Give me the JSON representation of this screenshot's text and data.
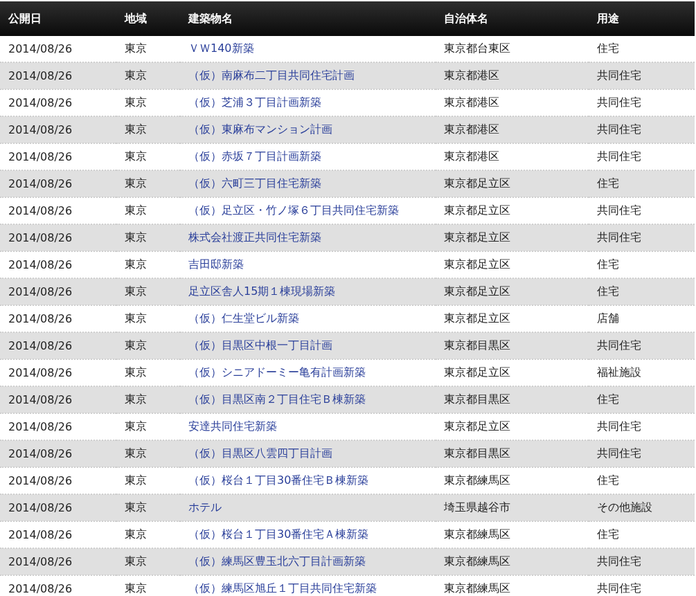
{
  "table": {
    "columns": [
      "公開日",
      "地域",
      "建築物名",
      "自治体名",
      "用途"
    ],
    "rows": [
      {
        "date": "2014/08/26",
        "region": "東京",
        "building": "ＶＷ140新築",
        "municipality": "東京都台東区",
        "use": "住宅"
      },
      {
        "date": "2014/08/26",
        "region": "東京",
        "building": "（仮）南麻布二丁目共同住宅計画",
        "municipality": "東京都港区",
        "use": "共同住宅"
      },
      {
        "date": "2014/08/26",
        "region": "東京",
        "building": "（仮）芝浦３丁目計画新築",
        "municipality": "東京都港区",
        "use": "共同住宅"
      },
      {
        "date": "2014/08/26",
        "region": "東京",
        "building": "（仮）東麻布マンション計画",
        "municipality": "東京都港区",
        "use": "共同住宅"
      },
      {
        "date": "2014/08/26",
        "region": "東京",
        "building": "（仮）赤坂７丁目計画新築",
        "municipality": "東京都港区",
        "use": "共同住宅"
      },
      {
        "date": "2014/08/26",
        "region": "東京",
        "building": "（仮）六町三丁目住宅新築",
        "municipality": "東京都足立区",
        "use": "住宅"
      },
      {
        "date": "2014/08/26",
        "region": "東京",
        "building": "（仮）足立区・竹ノ塚６丁目共同住宅新築",
        "municipality": "東京都足立区",
        "use": "共同住宅"
      },
      {
        "date": "2014/08/26",
        "region": "東京",
        "building": "株式会社渡正共同住宅新築",
        "municipality": "東京都足立区",
        "use": "共同住宅"
      },
      {
        "date": "2014/08/26",
        "region": "東京",
        "building": "吉田邸新築",
        "municipality": "東京都足立区",
        "use": "住宅"
      },
      {
        "date": "2014/08/26",
        "region": "東京",
        "building": "足立区舎人15期１棟現場新築",
        "municipality": "東京都足立区",
        "use": "住宅"
      },
      {
        "date": "2014/08/26",
        "region": "東京",
        "building": "（仮）仁生堂ビル新築",
        "municipality": "東京都足立区",
        "use": "店舗"
      },
      {
        "date": "2014/08/26",
        "region": "東京",
        "building": "（仮）目黒区中根一丁目計画",
        "municipality": "東京都目黒区",
        "use": "共同住宅"
      },
      {
        "date": "2014/08/26",
        "region": "東京",
        "building": "（仮）シニアドーミー亀有計画新築",
        "municipality": "東京都足立区",
        "use": "福祉施設"
      },
      {
        "date": "2014/08/26",
        "region": "東京",
        "building": "（仮）目黒区南２丁目住宅Ｂ棟新築",
        "municipality": "東京都目黒区",
        "use": "住宅"
      },
      {
        "date": "2014/08/26",
        "region": "東京",
        "building": "安達共同住宅新築",
        "municipality": "東京都足立区",
        "use": "共同住宅"
      },
      {
        "date": "2014/08/26",
        "region": "東京",
        "building": "（仮）目黒区八雲四丁目計画",
        "municipality": "東京都目黒区",
        "use": "共同住宅"
      },
      {
        "date": "2014/08/26",
        "region": "東京",
        "building": "（仮）桜台１丁目30番住宅Ｂ棟新築",
        "municipality": "東京都練馬区",
        "use": "住宅"
      },
      {
        "date": "2014/08/26",
        "region": "東京",
        "building": "ホテル",
        "municipality": "埼玉県越谷市",
        "use": "その他施設"
      },
      {
        "date": "2014/08/26",
        "region": "東京",
        "building": "（仮）桜台１丁目30番住宅Ａ棟新築",
        "municipality": "東京都練馬区",
        "use": "住宅"
      },
      {
        "date": "2014/08/26",
        "region": "東京",
        "building": "（仮）練馬区豊玉北六丁目計画新築",
        "municipality": "東京都練馬区",
        "use": "共同住宅"
      },
      {
        "date": "2014/08/26",
        "region": "東京",
        "building": "（仮）練馬区旭丘１丁目共同住宅新築",
        "municipality": "東京都練馬区",
        "use": "共同住宅"
      }
    ]
  }
}
